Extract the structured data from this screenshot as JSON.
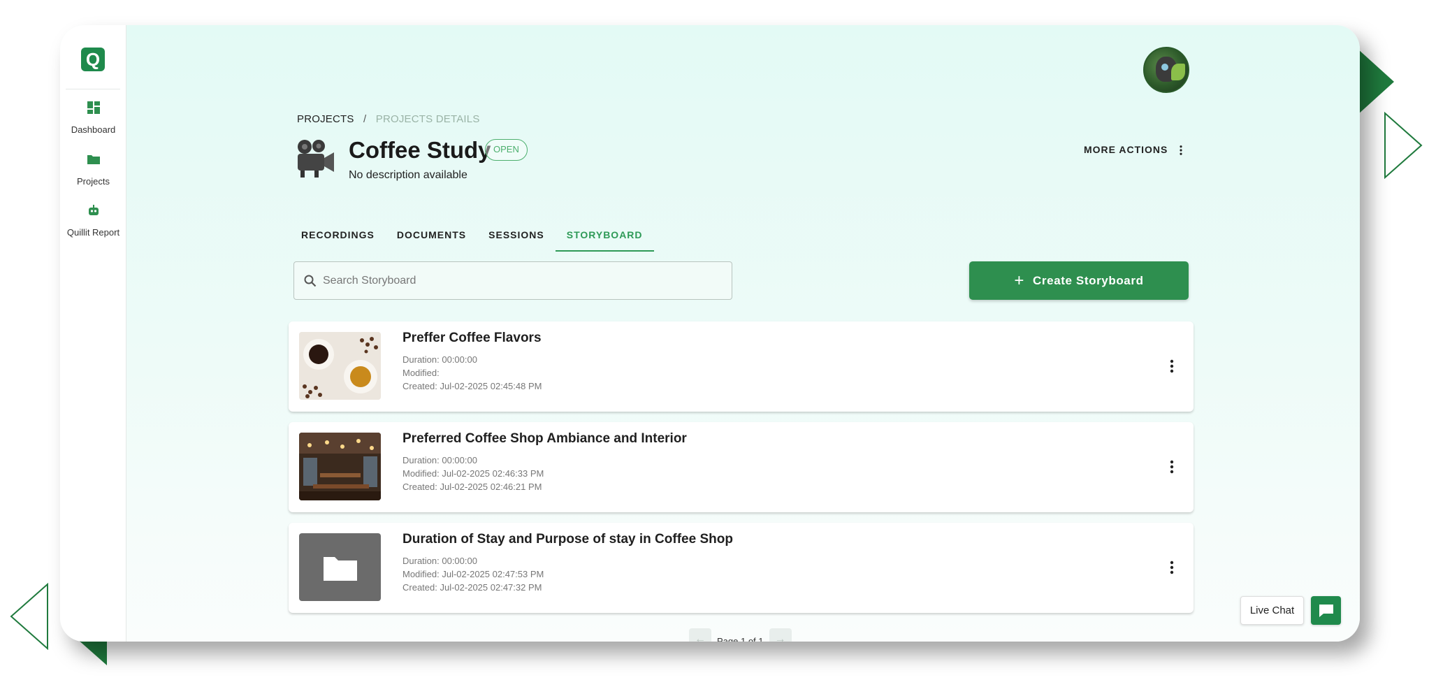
{
  "app": {
    "logo_letter": "Q",
    "accent_color": "#2e8f4f"
  },
  "sidebar": {
    "items": [
      {
        "label": "Dashboard",
        "icon": "dashboard-icon"
      },
      {
        "label": "Projects",
        "icon": "folder-icon"
      },
      {
        "label": "Quillit Report",
        "icon": "robot-icon"
      }
    ]
  },
  "breadcrumb": {
    "root": "PROJECTS",
    "separator": "/",
    "current": "PROJECTS DETAILS"
  },
  "project": {
    "title": "Coffee Study",
    "status": "OPEN",
    "description": "No description available",
    "more_actions_label": "MORE ACTIONS"
  },
  "tabs": [
    {
      "label": "RECORDINGS",
      "active": false
    },
    {
      "label": "DOCUMENTS",
      "active": false
    },
    {
      "label": "SESSIONS",
      "active": false
    },
    {
      "label": "STORYBOARD",
      "active": true
    }
  ],
  "search": {
    "placeholder": "Search Storyboard",
    "value": ""
  },
  "create_button": {
    "icon": "+",
    "label": "Create Storyboard"
  },
  "storyboards": [
    {
      "title": "Preffer Coffee Flavors",
      "duration": "Duration: 00:00:00",
      "modified": "Modified:",
      "created": "Created: Jul-02-2025 02:45:48 PM",
      "thumbnail": "coffee-cups-image"
    },
    {
      "title": "Preferred Coffee Shop Ambiance and Interior",
      "duration": "Duration: 00:00:00",
      "modified": "Modified: Jul-02-2025 02:46:33 PM",
      "created": "Created: Jul-02-2025 02:46:21 PM",
      "thumbnail": "coffee-shop-interior-image"
    },
    {
      "title": "Duration of Stay and Purpose of stay in Coffee Shop",
      "duration": "Duration: 00:00:00",
      "modified": "Modified: Jul-02-2025 02:47:53 PM",
      "created": "Created: Jul-02-2025 02:47:32 PM",
      "thumbnail": "folder-placeholder-icon"
    }
  ],
  "pagination": {
    "text": "Page 1 of 1",
    "prev": "←",
    "next": "→"
  },
  "live_chat": {
    "label": "Live Chat",
    "icon": "chat-icon"
  }
}
